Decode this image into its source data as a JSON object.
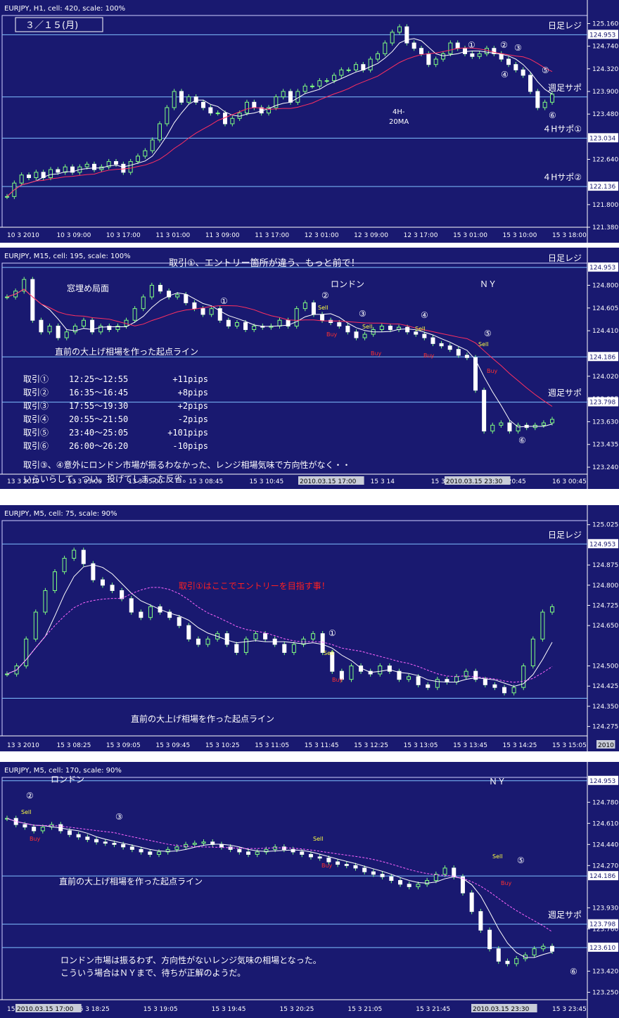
{
  "panels": [
    {
      "id": "p1",
      "top": 0,
      "height": 345,
      "header": "EURJPY, H1, cell: 420, scale: 100%",
      "date_box": "３／１５(月)",
      "y_min": 121.38,
      "y_max": 125.31,
      "price_ticks": [
        "125.160",
        "124.740",
        "124.320",
        "123.900",
        "123.480",
        "122.640",
        "121.800",
        "121.380"
      ],
      "price_tick_values": [
        125.16,
        124.74,
        124.32,
        123.9,
        123.48,
        122.64,
        121.8,
        121.38
      ],
      "h_lines": [
        {
          "value": 124.953,
          "label": "124.953",
          "text": "日足レジ"
        },
        {
          "value": 123.798,
          "label": "",
          "text": "週足サポ"
        },
        {
          "value": 123.034,
          "label": "123.034",
          "text": "４Hサポ①"
        },
        {
          "value": 122.136,
          "label": "122.136",
          "text": "４Hサポ②"
        }
      ],
      "time_labels": [
        "10 3 2010",
        "10 3 09:00",
        "10 3 17:00",
        "11 3 01:00",
        "11 3 09:00",
        "11 3 17:00",
        "12 3 01:00",
        "12 3 09:00",
        "12 3 17:00",
        "15 3 01:00",
        "15 3 10:00",
        "15 3 18:00"
      ],
      "annotations": [
        {
          "text": "4H-"
        },
        {
          "text": "20MA"
        }
      ],
      "markers": [
        "①",
        "②",
        "③",
        "④",
        "⑤",
        "⑥"
      ],
      "chart_data": {
        "type": "candlestick",
        "symbol": "EURJPY",
        "timeframe": "H1",
        "ylim": [
          121.38,
          125.31
        ],
        "close_path": [
          121.95,
          122.2,
          122.35,
          122.3,
          122.4,
          122.3,
          122.45,
          122.4,
          122.5,
          122.4,
          122.5,
          122.55,
          122.45,
          122.5,
          122.6,
          122.55,
          122.4,
          122.6,
          122.7,
          122.8,
          123.0,
          123.3,
          123.6,
          123.9,
          123.7,
          123.8,
          123.7,
          123.6,
          123.5,
          123.5,
          123.3,
          123.4,
          123.5,
          123.7,
          123.6,
          123.5,
          123.6,
          123.8,
          123.9,
          123.7,
          123.9,
          124.0,
          124.0,
          124.1,
          124.1,
          124.2,
          124.3,
          124.3,
          124.4,
          124.3,
          124.5,
          124.6,
          124.8,
          125.0,
          125.1,
          124.8,
          124.7,
          124.6,
          124.4,
          124.5,
          124.6,
          124.8,
          124.7,
          124.6,
          124.55,
          124.6,
          124.7,
          124.6,
          124.5,
          124.4,
          124.3,
          124.2,
          123.9,
          123.6,
          123.7,
          123.85
        ]
      }
    },
    {
      "id": "p2",
      "top": 352,
      "height": 343,
      "header": "EURJPY, M15, cell: 195, scale: 100%",
      "title_note": "取引①、エントリー箇所が違う、もっと前で！",
      "y_min": 123.18,
      "y_max": 124.99,
      "price_ticks": [
        "124.800",
        "124.605",
        "124.410",
        "124.020",
        "123.825",
        "123.630",
        "123.435",
        "123.240"
      ],
      "price_tick_values": [
        124.8,
        124.605,
        124.41,
        124.02,
        123.825,
        123.63,
        123.435,
        123.24
      ],
      "h_lines": [
        {
          "value": 124.953,
          "label": "124.953",
          "text": "日足レジ"
        },
        {
          "value": 124.186,
          "label": "124.186",
          "text": ""
        },
        {
          "value": 123.798,
          "label": "123.798",
          "text": "週足サポ"
        }
      ],
      "time_labels": [
        "13 3 2010",
        "13 3 03:00",
        "13 3 05:00",
        "15 3 08:45",
        "15 3 10:45",
        "15 3 12:45",
        "15 3 14",
        "15 3 18:45",
        "15 3 20:45",
        "16 3 00:45"
      ],
      "time_highlights": [
        "2010.03.15 17:00",
        "2010.03.15 23:30"
      ],
      "labels": {
        "range": "窓埋め局面",
        "london": "ロンドン",
        "ny": "ＮＹ",
        "startline": "直前の大上げ相場を作った起点ライン"
      },
      "trades": [
        {
          "name": "取引①",
          "time": "12:25～12:55",
          "pips": "+11pips"
        },
        {
          "name": "取引②",
          "time": "16:35～16:45",
          "pips": "+8pips"
        },
        {
          "name": "取引③",
          "time": "17:55～19:30",
          "pips": "+2pips"
        },
        {
          "name": "取引④",
          "time": "20:55～21:50",
          "pips": "-2pips"
        },
        {
          "name": "取引⑤",
          "time": "23:40～25:05",
          "pips": "+101pips"
        },
        {
          "name": "取引⑥",
          "time": "26:00～26:20",
          "pips": "-10pips"
        }
      ],
      "comment_1": "取引③、④意外にロンドン市場が振るわなかった、レンジ相場気味で方向性がなく・・",
      "comment_2": "いらいらして、つい、投げてしまった反省。",
      "markers": [
        "①",
        "②",
        "③",
        "④",
        "⑤",
        "⑥"
      ],
      "signals": {
        "sell": "Sell",
        "buy": "Buy"
      },
      "chart_data": {
        "type": "candlestick",
        "symbol": "EURJPY",
        "timeframe": "M15",
        "ylim": [
          123.18,
          124.99
        ],
        "close_path": [
          124.7,
          124.75,
          124.85,
          124.5,
          124.4,
          124.45,
          124.35,
          124.4,
          124.45,
          124.5,
          124.4,
          124.45,
          124.42,
          124.45,
          124.5,
          124.6,
          124.7,
          124.8,
          124.75,
          124.7,
          124.72,
          124.65,
          124.6,
          124.55,
          124.6,
          124.5,
          124.45,
          124.48,
          124.42,
          124.45,
          124.44,
          124.45,
          124.5,
          124.45,
          124.6,
          124.65,
          124.55,
          124.5,
          124.48,
          124.45,
          124.4,
          124.35,
          124.38,
          124.42,
          124.45,
          124.42,
          124.44,
          124.4,
          124.38,
          124.35,
          124.3,
          124.28,
          124.25,
          124.2,
          124.18,
          123.9,
          123.55,
          123.6,
          123.62,
          123.55,
          123.6,
          123.58,
          123.6,
          123.62,
          123.65
        ]
      }
    },
    {
      "id": "p3",
      "top": 718,
      "height": 350,
      "header": "EURJPY, M5, cell: 75, scale: 90%",
      "title_note": "取引①はここでエントリーを目指す事！",
      "y_min": 124.24,
      "y_max": 125.04,
      "price_ticks": [
        "125.025",
        "124.875",
        "124.800",
        "124.725",
        "124.650",
        "124.500",
        "124.425",
        "124.350",
        "124.275"
      ],
      "price_tick_values": [
        125.025,
        124.875,
        124.8,
        124.725,
        124.65,
        124.5,
        124.425,
        124.35,
        124.275
      ],
      "h_lines": [
        {
          "value": 124.953,
          "label": "124.953",
          "text": "日足レジ"
        },
        {
          "value": 124.38,
          "label": "",
          "text": ""
        }
      ],
      "time_labels": [
        "13 3 2010",
        "15 3 08:25",
        "15 3 09:05",
        "15 3 09:45",
        "15 3 10:25",
        "15 3 11:05",
        "15 3 11:45",
        "15 3 12:25",
        "15 3 13:05",
        "15 3 13:45",
        "15 3 14:25",
        "15 3 15:05"
      ],
      "time_highlights": [
        "2010"
      ],
      "labels": {
        "startline": "直前の大上げ相場を作った起点ライン"
      },
      "markers": [
        "①"
      ],
      "signals": {
        "sell": "Sell",
        "buy": "Buy"
      },
      "chart_data": {
        "type": "candlestick",
        "symbol": "EURJPY",
        "timeframe": "M5",
        "ylim": [
          124.24,
          125.04
        ],
        "close_path": [
          124.47,
          124.5,
          124.6,
          124.7,
          124.78,
          124.85,
          124.9,
          124.93,
          124.88,
          124.82,
          124.8,
          124.78,
          124.75,
          124.7,
          124.68,
          124.72,
          124.7,
          124.68,
          124.65,
          124.6,
          124.58,
          124.6,
          124.62,
          124.58,
          124.55,
          124.6,
          124.62,
          124.6,
          124.58,
          124.55,
          124.58,
          124.6,
          124.62,
          124.55,
          124.48,
          124.45,
          124.5,
          124.48,
          124.47,
          124.5,
          124.48,
          124.45,
          124.46,
          124.43,
          124.42,
          124.45,
          124.44,
          124.46,
          124.48,
          124.45,
          124.43,
          124.42,
          124.4,
          124.42,
          124.5,
          124.6,
          124.7,
          124.72
        ]
      }
    },
    {
      "id": "p4",
      "top": 1083,
      "height": 364,
      "header": "EURJPY, M5, cell: 170, scale: 90%",
      "y_min": 123.19,
      "y_max": 124.98,
      "price_ticks": [
        "124.780",
        "124.610",
        "124.440",
        "124.270",
        "123.930",
        "123.760",
        "123.420",
        "123.250"
      ],
      "price_tick_values": [
        124.78,
        124.61,
        124.44,
        124.27,
        123.93,
        123.76,
        123.42,
        123.25
      ],
      "h_lines": [
        {
          "value": 124.953,
          "label": "124.953",
          "text": ""
        },
        {
          "value": 124.186,
          "label": "124.186",
          "text": ""
        },
        {
          "value": 123.798,
          "label": "123.798",
          "text": "週足サポ"
        },
        {
          "value": 123.61,
          "label": "123.610",
          "text": ""
        }
      ],
      "time_labels": [
        "15 3 17:45",
        "15 3 18:25",
        "15 3 19:05",
        "15 3 19:45",
        "15 3 20:25",
        "15 3 21:05",
        "15 3 21:45",
        "15 3 22:25",
        "15 3 23:45"
      ],
      "time_highlights": [
        "2010.03.15 17:00",
        "2010.03.15 23:30"
      ],
      "labels": {
        "london": "ロンドン",
        "ny": "ＮＹ",
        "startline": "直前の大上げ相場を作った起点ライン"
      },
      "comment_1": "ロンドン市場は振るわず、方向性がないレンジ気味の相場となった。",
      "comment_2": "こういう場合はＮＹまで、待ちが正解のようだ。",
      "markers": [
        "②",
        "③",
        "⑤",
        "⑥"
      ],
      "signals": {
        "sell": "Sell",
        "buy": "Buy"
      },
      "chart_data": {
        "type": "candlestick",
        "symbol": "EURJPY",
        "timeframe": "M5",
        "ylim": [
          123.19,
          124.98
        ],
        "close_path": [
          124.65,
          124.6,
          124.58,
          124.55,
          124.58,
          124.6,
          124.55,
          124.52,
          124.5,
          124.48,
          124.46,
          124.45,
          124.44,
          124.42,
          124.4,
          124.38,
          124.36,
          124.38,
          124.4,
          124.42,
          124.44,
          124.45,
          124.46,
          124.44,
          124.42,
          124.4,
          124.38,
          124.36,
          124.38,
          124.4,
          124.42,
          124.4,
          124.38,
          124.36,
          124.34,
          124.33,
          124.3,
          124.28,
          124.27,
          124.25,
          124.22,
          124.2,
          124.18,
          124.15,
          124.12,
          124.1,
          124.12,
          124.15,
          124.2,
          124.25,
          124.18,
          124.05,
          123.9,
          123.75,
          123.6,
          123.5,
          123.48,
          123.52,
          123.55,
          123.6,
          123.62,
          123.58
        ]
      }
    }
  ]
}
